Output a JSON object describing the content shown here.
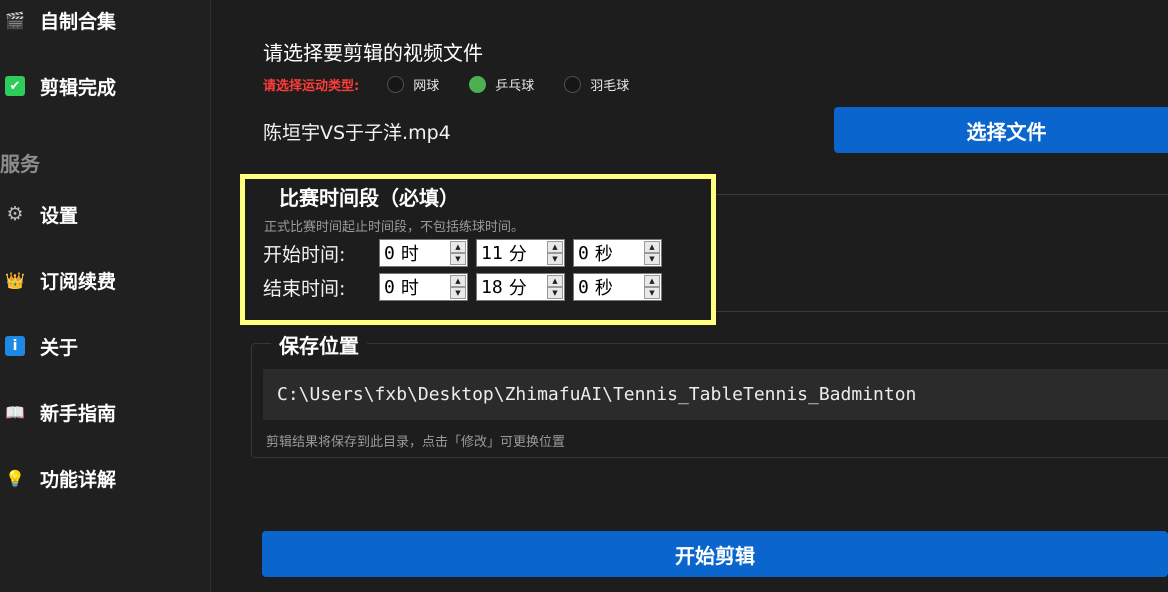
{
  "sidebar": {
    "section_label": "服务",
    "items": [
      {
        "icon": "clapperboard-icon",
        "glyph": "🎬",
        "label": "自制合集"
      },
      {
        "icon": "checkbox-icon",
        "glyph": "✔",
        "label": "剪辑完成"
      },
      {
        "icon": "gear-icon",
        "glyph": "⚙",
        "label": "设置"
      },
      {
        "icon": "crown-icon",
        "glyph": "👑",
        "label": "订阅续费"
      },
      {
        "icon": "info-icon",
        "glyph": "i",
        "label": "关于"
      },
      {
        "icon": "book-icon",
        "glyph": "📖",
        "label": "新手指南"
      },
      {
        "icon": "lightbulb-icon",
        "glyph": "💡",
        "label": "功能详解"
      }
    ]
  },
  "main": {
    "file_title": "请选择要剪辑的视频文件",
    "sport_label": "请选择运动类型:",
    "sports": [
      {
        "label": "网球",
        "checked": false
      },
      {
        "label": "乒乓球",
        "checked": true
      },
      {
        "label": "羽毛球",
        "checked": false
      }
    ],
    "filename": "陈垣宇VS于子洋.mp4",
    "select_file_button": "选择文件",
    "match_time": {
      "title": "比赛时间段（必填）",
      "hint": "正式比赛时间起止时间段，不包括练球时间。",
      "start": {
        "label": "开始时间:",
        "hour": "0",
        "hour_unit": "时",
        "minute": "11",
        "minute_unit": "分",
        "second": "0",
        "second_unit": "秒"
      },
      "end": {
        "label": "结束时间:",
        "hour": "0",
        "hour_unit": "时",
        "minute": "18",
        "minute_unit": "分",
        "second": "0",
        "second_unit": "秒"
      }
    },
    "save_location": {
      "title": "保存位置",
      "path": "C:\\Users\\fxb\\Desktop\\ZhimafuAI\\Tennis_TableTennis_Badminton",
      "hint": "剪辑结果将保存到此目录，点击「修改」可更换位置"
    },
    "start_button": "开始剪辑"
  },
  "colors": {
    "accent": "#0a66cc",
    "radio_checked": "#4caf50",
    "warning_text": "#ff3b3b",
    "highlight": "#ffff80",
    "background": "#1d1d1d"
  }
}
